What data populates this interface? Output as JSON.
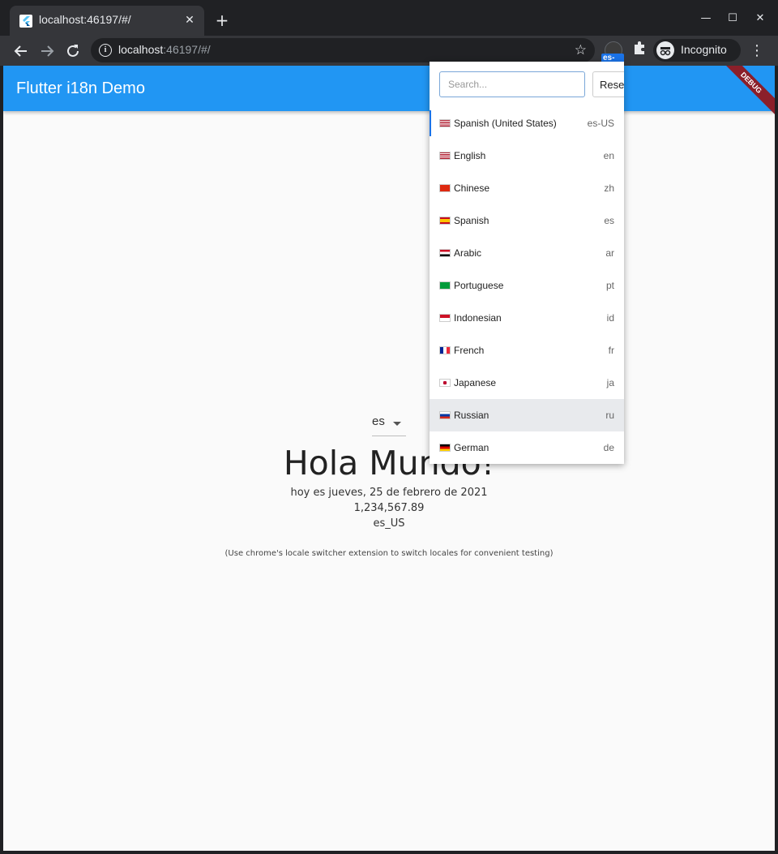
{
  "browser": {
    "tab_title": "localhost:46197/#/",
    "new_tab_symbol": "+",
    "url_host": "localhost",
    "url_rest": ":46197/#/",
    "extension_badge": "es-US",
    "incognito_label": "Incognito"
  },
  "app": {
    "title": "Flutter i18n Demo",
    "debug_banner": "DEBUG",
    "locale_dropdown_value": "es",
    "greeting": "Hola Mundo!",
    "date_line": "hoy es jueves, 25 de febrero de 2021",
    "number_line": "1,234,567.89",
    "locale_line": "es_US",
    "note": "(Use chrome's locale switcher extension to switch locales for convenient testing)"
  },
  "popup": {
    "search_placeholder": "Search...",
    "reset_label": "Reset",
    "items": [
      {
        "name": "Spanish (United States)",
        "code": "es-US",
        "flag": "US"
      },
      {
        "name": "English",
        "code": "en",
        "flag": "US"
      },
      {
        "name": "Chinese",
        "code": "zh",
        "flag": "CN"
      },
      {
        "name": "Spanish",
        "code": "es",
        "flag": "ES"
      },
      {
        "name": "Arabic",
        "code": "ar",
        "flag": "EG"
      },
      {
        "name": "Portuguese",
        "code": "pt",
        "flag": "BR"
      },
      {
        "name": "Indonesian",
        "code": "id",
        "flag": "ID"
      },
      {
        "name": "French",
        "code": "fr",
        "flag": "FR"
      },
      {
        "name": "Japanese",
        "code": "ja",
        "flag": "JP"
      },
      {
        "name": "Russian",
        "code": "ru",
        "flag": "RU"
      },
      {
        "name": "German",
        "code": "de",
        "flag": "DE"
      }
    ]
  },
  "colors": {
    "appbar": "#2196f3",
    "chrome_dark": "#202124",
    "chrome_toolbar": "#35363a",
    "debug_banner": "#8b1f2a"
  }
}
